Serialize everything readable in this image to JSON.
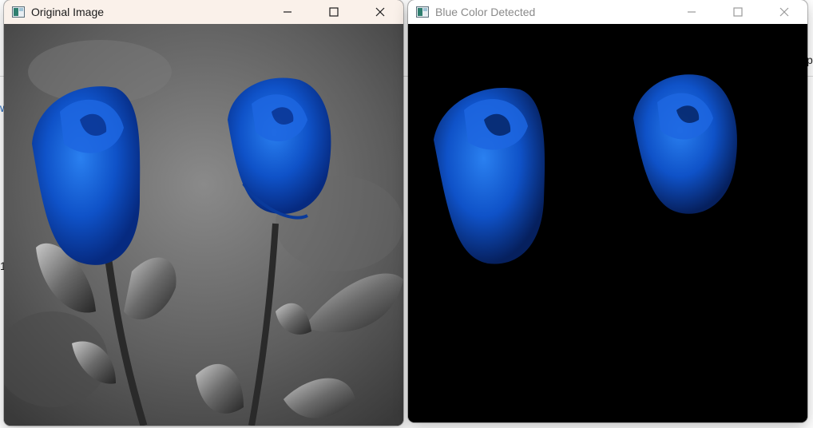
{
  "background": {
    "fragments": [
      "w",
      "1",
      "p"
    ]
  },
  "windows": [
    {
      "id": "original",
      "title": "Original Image",
      "active": true,
      "icon": "opencv-window-icon",
      "image_desc_name": "grayscale-roses-with-blue-flowers"
    },
    {
      "id": "blue-detected",
      "title": "Blue Color Detected",
      "active": false,
      "icon": "opencv-window-icon",
      "image_desc_name": "blue-mask-roses-on-black"
    }
  ],
  "colors": {
    "rose_blue": "#0f52c8",
    "rose_blue_light": "#2a80f0",
    "rose_blue_dark": "#062a80",
    "mask_bg": "#000000",
    "active_titlebar": "#faf1ea",
    "inactive_titlebar": "#ffffff"
  }
}
